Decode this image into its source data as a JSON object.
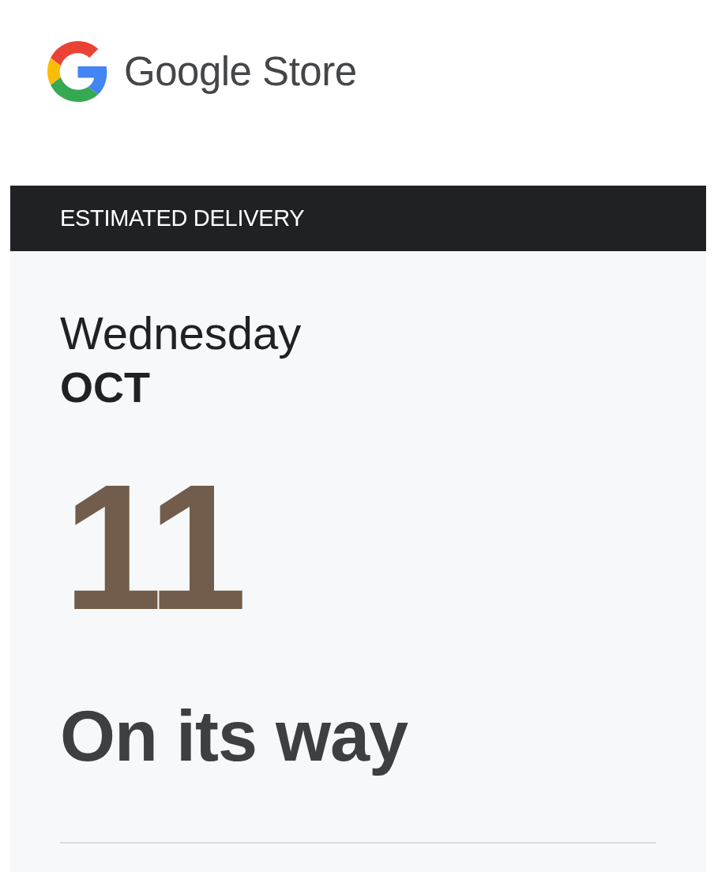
{
  "header": {
    "brand": "Google Store"
  },
  "banner": {
    "label": "ESTIMATED DELIVERY"
  },
  "delivery": {
    "weekday": "Wednesday",
    "month": "OCT",
    "day": "11",
    "status": "On its way"
  }
}
